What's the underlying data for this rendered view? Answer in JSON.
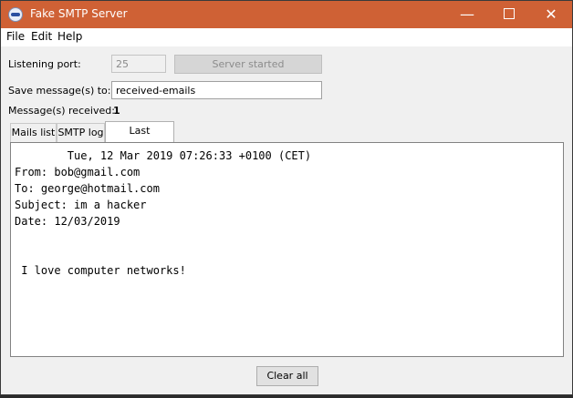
{
  "window": {
    "title": "Fake SMTP Server"
  },
  "menu": {
    "file": "File",
    "edit": "Edit",
    "help": "Help"
  },
  "form": {
    "port_label": "Listening port:",
    "port_value": "25",
    "server_button": "Server started",
    "save_label": "Save message(s) to:",
    "save_value": "received-emails",
    "received_label": "Message(s) received:",
    "received_count": "1"
  },
  "tabs": [
    {
      "label": "Mails list",
      "selected": false
    },
    {
      "label": "SMTP log",
      "selected": false
    },
    {
      "label": "Last message",
      "selected": true
    }
  ],
  "message": {
    "text": "        Tue, 12 Mar 2019 07:26:33 +0100 (CET)\nFrom: bob@gmail.com\nTo: george@hotmail.com\nSubject: im a hacker\nDate: 12/03/2019\n\n\n I love computer networks!"
  },
  "footer": {
    "clear_button": "Clear all"
  },
  "colors": {
    "titlebar": "#cf6135"
  },
  "icons": {
    "app": "smtp-app-icon",
    "minimize": "minimize-icon",
    "maximize": "maximize-icon",
    "close": "close-icon"
  }
}
